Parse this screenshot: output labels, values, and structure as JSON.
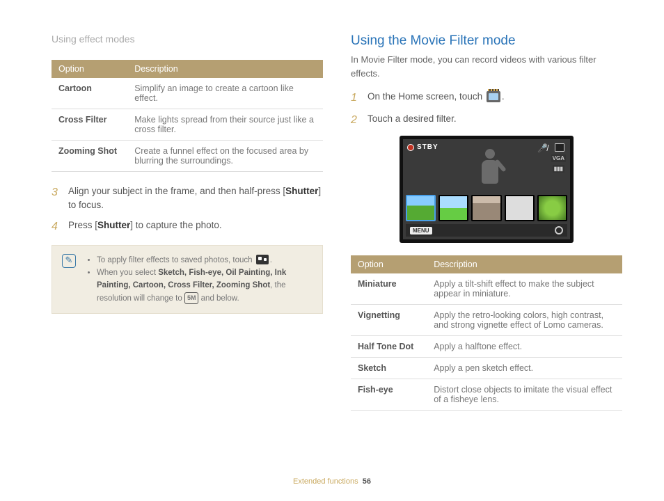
{
  "breadcrumb": "Using effect modes",
  "left": {
    "table_headers": {
      "option": "Option",
      "description": "Description"
    },
    "table_rows": [
      {
        "option": "Cartoon",
        "desc": "Simplify an image to create a cartoon like effect."
      },
      {
        "option": "Cross Filter",
        "desc": "Make lights spread from their source just like a cross filter."
      },
      {
        "option": "Zooming Shot",
        "desc": "Create a funnel effect on the focused area by blurring the surroundings."
      }
    ],
    "step3": {
      "num": "3",
      "text_pre": "Align your subject in the frame, and then half-press [",
      "bold": "Shutter",
      "text_post": "] to focus."
    },
    "step4": {
      "num": "4",
      "text_pre": "Press [",
      "bold": "Shutter",
      "text_post": "] to capture the photo."
    },
    "note": {
      "line1_pre": "To apply filter effects to saved photos, touch ",
      "line1_post": ".",
      "line2_pre": "When you select ",
      "bold_list": "Sketch, Fish-eye, Oil Painting, Ink Painting, Cartoon, Cross Filter, Zooming Shot",
      "line2_mid": ", the resolution will change to ",
      "res_badge": "5M",
      "line2_post": " and below."
    }
  },
  "right": {
    "heading": "Using the Movie Filter mode",
    "intro": "In Movie Filter mode, you can record videos with various filter effects.",
    "step1": {
      "num": "1",
      "text_pre": "On the Home screen, touch ",
      "text_post": "."
    },
    "step2": {
      "num": "2",
      "text": "Touch a desired filter."
    },
    "screen": {
      "stby": "STBY",
      "menu": "MENU",
      "vga": "VGA"
    },
    "table_headers": {
      "option": "Option",
      "description": "Description"
    },
    "table_rows": [
      {
        "option": "Miniature",
        "desc": "Apply a tilt-shift effect to make the subject appear in miniature."
      },
      {
        "option": "Vignetting",
        "desc": "Apply the retro-looking colors, high contrast, and strong vignette effect of Lomo cameras."
      },
      {
        "option": "Half Tone Dot",
        "desc": "Apply a halftone effect."
      },
      {
        "option": "Sketch",
        "desc": "Apply a pen sketch effect."
      },
      {
        "option": "Fish-eye",
        "desc": "Distort close objects to imitate the visual effect of a fisheye lens."
      }
    ]
  },
  "footer": {
    "section": "Extended functions",
    "page": "56"
  }
}
